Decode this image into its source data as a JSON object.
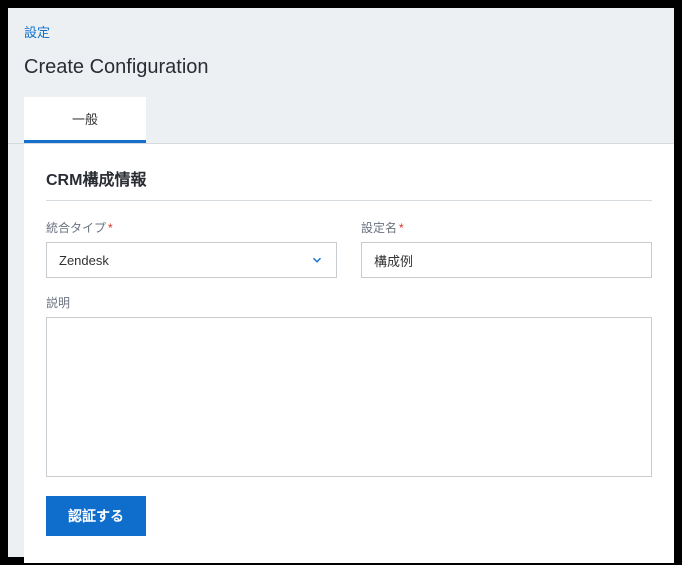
{
  "breadcrumb": {
    "settings": "設定"
  },
  "page_title": "Create Configuration",
  "tabs": {
    "general": "一般"
  },
  "section": {
    "title": "CRM構成情報"
  },
  "form": {
    "integration_type": {
      "label": "統合タイプ",
      "required": "*",
      "value": "Zendesk"
    },
    "config_name": {
      "label": "設定名",
      "required": "*",
      "value": "構成例"
    },
    "description": {
      "label": "説明",
      "value": ""
    }
  },
  "buttons": {
    "authenticate": "認証する"
  }
}
